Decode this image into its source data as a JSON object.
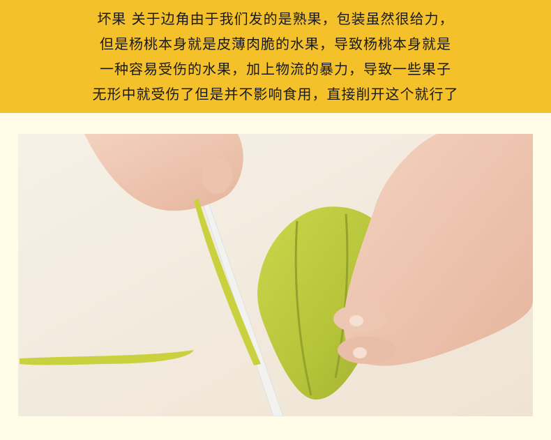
{
  "banner": {
    "lines": [
      "坏果 关于边角由于我们发的是熟果，包装虽然很给力，",
      "但是杨桃本身就是皮薄肉脆的水果，导致杨桃本身就是",
      "一种容易受伤的水果，加上物流的暴力，导致一些果子",
      "无形中就受伤了但是并不影响食用，直接削开这个就行了"
    ]
  },
  "colors": {
    "banner_bg": "#f4c12a",
    "page_bg": "#fffde8",
    "fruit": "#b9c93a"
  },
  "photo": {
    "icon": "star-fruit-cutting-photo"
  }
}
